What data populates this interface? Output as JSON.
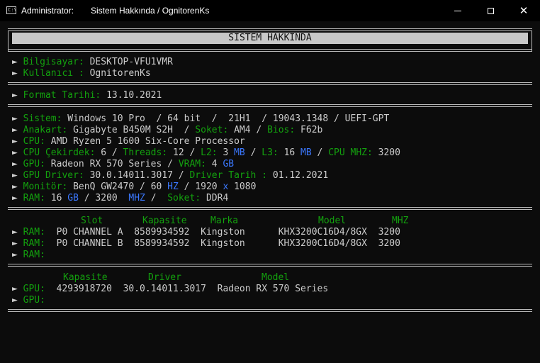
{
  "window": {
    "title_left": "Administrator:",
    "title_right": "Sistem Hakkında / OgnitorenKs",
    "icon_text": "C:\\",
    "minimize_glyph": "",
    "close_glyph": "✕"
  },
  "header": "SİSTEM HAKKINDA",
  "arrow": "►",
  "user": {
    "bilgisayar_label": "Bilgisayar:",
    "bilgisayar_value": "DESKTOP-VFU1VMR",
    "kullanici_label": "Kullanıcı :",
    "kullanici_value": "OgnitorenKs"
  },
  "format": {
    "label": "Format Tarihi:",
    "value": "13.10.2021"
  },
  "system": {
    "sistem_label": "Sistem:",
    "sistem_os": "Windows 10 Pro",
    "sistem_bit": "64 bit",
    "sistem_ver": "21H1",
    "sistem_build": "19043.1348",
    "sistem_boot": "UEFI-GPT",
    "anakart_label": "Anakart:",
    "anakart_value": "Gigabyte B450M S2H",
    "soket_label": "Soket:",
    "soket_value": "AM4",
    "bios_label": "Bios:",
    "bios_value": "F62b",
    "cpu_label": "CPU:",
    "cpu_value": "AMD Ryzen 5 1600 Six-Core Processor",
    "cekirdek_label": "CPU Çekirdek:",
    "cekirdek_value": "6",
    "threads_label": "Threads:",
    "threads_value": "12",
    "l2_label": "L2:",
    "l2_value": "3",
    "l3_label": "L3:",
    "l3_value": "16",
    "mb_unit": "MB",
    "mhz_label": "CPU MHZ:",
    "mhz_value": "3200",
    "gpu_label": "GPU:",
    "gpu_value": "Radeon RX 570 Series",
    "vram_label": "VRAM:",
    "vram_value": "4",
    "gb_unit": "GB",
    "gpu_driver_label": "GPU Driver:",
    "gpu_driver_value": "30.0.14011.3017",
    "driver_tarih_label": "Driver Tarih :",
    "driver_tarih_value": "01.12.2021",
    "monitor_label": "Monitör:",
    "monitor_value": "BenQ GW2470",
    "hz_value": "60",
    "hz_unit": "HZ",
    "res_w": "1920",
    "res_x": "x",
    "res_h": "1080",
    "ram_label": "RAM:",
    "ram_value": "16",
    "ram_speed": "3200",
    "mhz_unit": "MHZ",
    "ram_soket_label": "Soket:",
    "ram_soket_value": "DDR4",
    "slash": "/"
  },
  "ram_table": {
    "headers": [
      "Slot",
      "Kapasite",
      "Marka",
      "Model",
      "MHZ"
    ],
    "label": "RAM:",
    "rows": [
      {
        "slot": "P0 CHANNEL A",
        "capacity": "8589934592",
        "brand": "Kingston",
        "model": "KHX3200C16D4/8GX",
        "mhz": "3200"
      },
      {
        "slot": "P0 CHANNEL B",
        "capacity": "8589934592",
        "brand": "Kingston",
        "model": "KHX3200C16D4/8GX",
        "mhz": "3200"
      }
    ]
  },
  "gpu_table": {
    "headers": [
      "Kapasite",
      "Driver",
      "Model"
    ],
    "label": "GPU:",
    "rows": [
      {
        "capacity": "4293918720",
        "driver": "30.0.14011.3017",
        "model": "Radeon RX 570 Series"
      }
    ]
  }
}
